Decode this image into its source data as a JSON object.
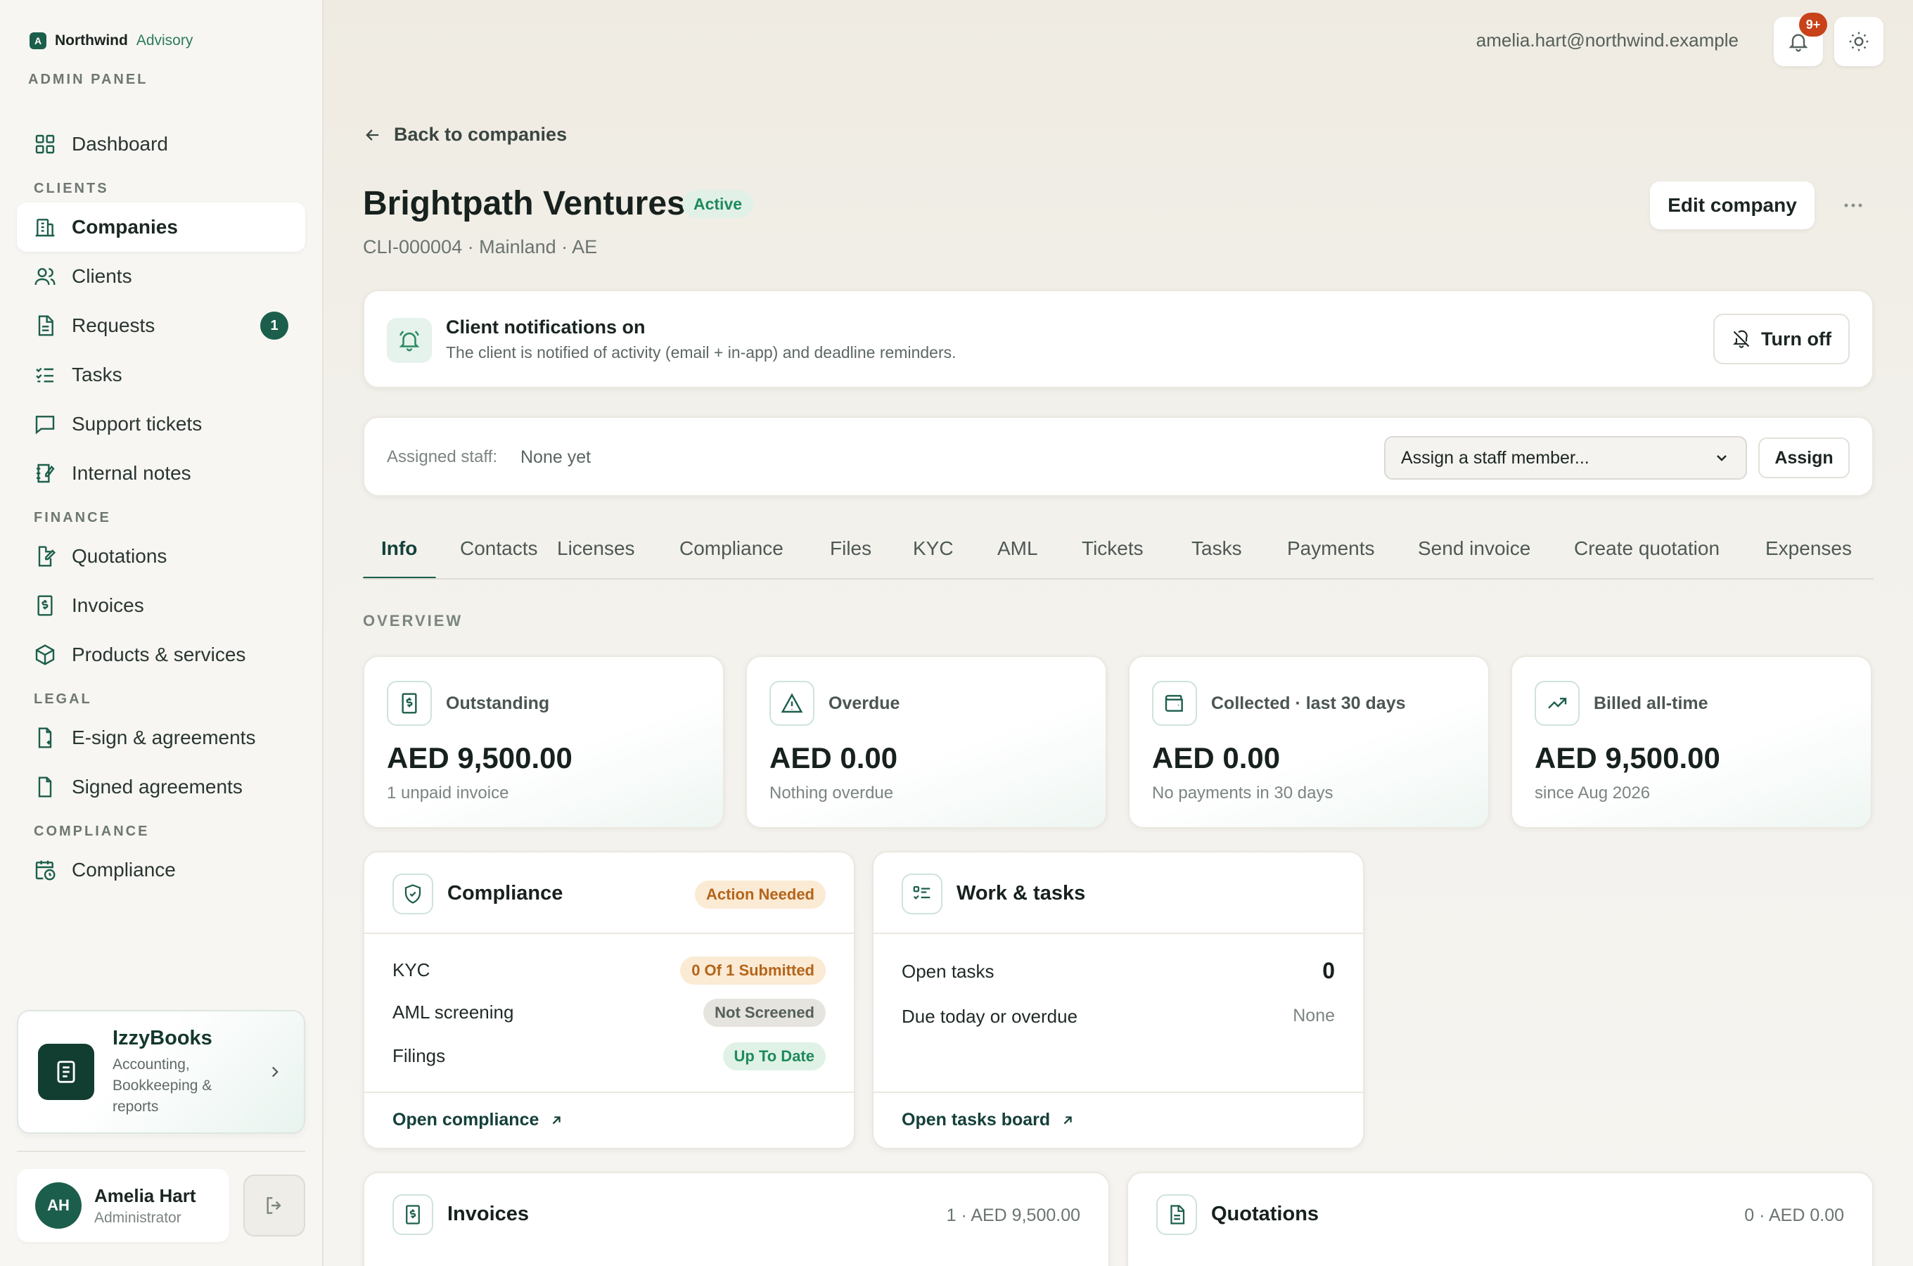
{
  "brand": {
    "mark": "A",
    "name": "Northwind",
    "sub": "Advisory",
    "panel_label": "ADMIN PANEL"
  },
  "nav": {
    "dashboard": "Dashboard",
    "section_clients": "CLIENTS",
    "companies": "Companies",
    "clients": "Clients",
    "requests": "Requests",
    "requests_badge": "1",
    "tasks": "Tasks",
    "support_tickets": "Support tickets",
    "internal_notes": "Internal notes",
    "section_finance": "FINANCE",
    "quotations": "Quotations",
    "invoices": "Invoices",
    "products": "Products & services",
    "section_legal": "LEGAL",
    "esign": "E-sign & agreements",
    "signed": "Signed agreements",
    "section_compliance": "COMPLIANCE",
    "compliance": "Compliance"
  },
  "promo": {
    "title": "IzzyBooks",
    "desc": "Accounting, Bookkeeping & reports"
  },
  "user": {
    "initials": "AH",
    "name": "Amelia Hart",
    "role": "Administrator"
  },
  "topbar": {
    "email": "amelia.hart@northwind.example",
    "notif_count": "9+"
  },
  "page": {
    "back": "Back to companies",
    "title": "Brightpath Ventures",
    "status": "Active",
    "meta": "CLI-000004 · Mainland · AE",
    "edit": "Edit company"
  },
  "notification": {
    "title": "Client notifications on",
    "desc": "The client is notified of activity (email + in-app) and deadline reminders.",
    "button": "Turn off"
  },
  "staff": {
    "label": "Assigned staff:",
    "value": "None yet",
    "select_placeholder": "Assign a staff member...",
    "assign": "Assign"
  },
  "tabs": [
    "Info",
    "Contacts",
    "Licenses",
    "Compliance",
    "Files",
    "KYC",
    "AML",
    "Tickets",
    "Tasks",
    "Payments",
    "Send invoice",
    "Create quotation",
    "Expenses"
  ],
  "overview": {
    "label": "OVERVIEW",
    "stats": [
      {
        "label": "Outstanding",
        "value": "AED 9,500.00",
        "sub": "1 unpaid invoice"
      },
      {
        "label": "Overdue",
        "value": "AED 0.00",
        "sub": "Nothing overdue"
      },
      {
        "label": "Collected · last 30 days",
        "value": "AED 0.00",
        "sub": "No payments in 30 days"
      },
      {
        "label": "Billed all-time",
        "value": "AED 9,500.00",
        "sub": "since Aug 2026"
      }
    ]
  },
  "compliance_panel": {
    "title": "Compliance",
    "status": "Action Needed",
    "rows": [
      {
        "label": "KYC",
        "value": "0 Of 1 Submitted"
      },
      {
        "label": "AML screening",
        "value": "Not Screened"
      },
      {
        "label": "Filings",
        "value": "Up To Date"
      }
    ],
    "link": "Open compliance"
  },
  "work_panel": {
    "title": "Work & tasks",
    "open_label": "Open tasks",
    "open_value": "0",
    "due_label": "Due today or overdue",
    "due_value": "None",
    "link": "Open tasks board"
  },
  "invoices_card": {
    "title": "Invoices",
    "meta": "1 · AED 9,500.00"
  },
  "quotations_card": {
    "title": "Quotations",
    "meta": "0 · AED 0.00"
  },
  "colors": {
    "accent": "#1c5e4c",
    "badge": "#c8421a",
    "active_green": "#1f8a5c",
    "warn": "#b4651a"
  }
}
